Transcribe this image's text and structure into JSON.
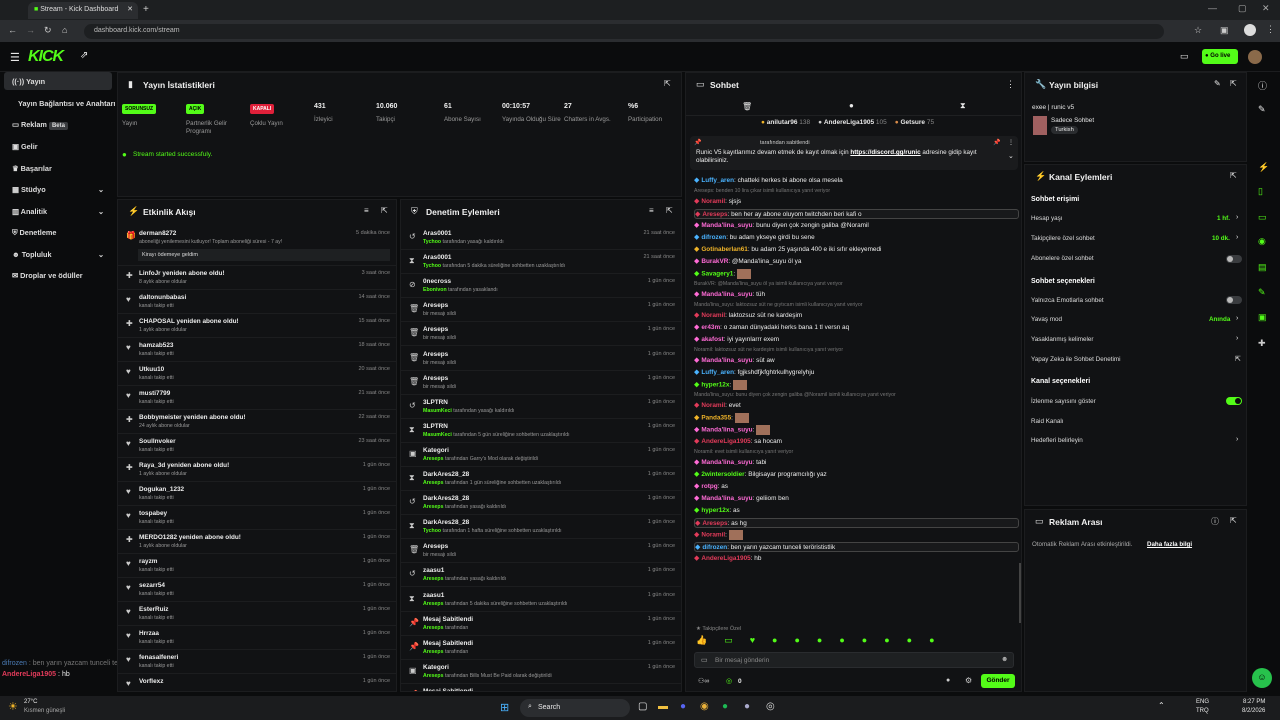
{
  "browser": {
    "tab_title": "Stream - Kick Dashboard",
    "url": "dashboard.kick.com/stream"
  },
  "topnav": {
    "logo": "KICK",
    "live_button": "Go live"
  },
  "sidebar": {
    "items": [
      {
        "label": "Yayın",
        "icon": "broadcast-icon"
      },
      {
        "label": "Yayın Bağlantısı ve Anahtarı",
        "icon": ""
      },
      {
        "label": "Reklam",
        "badge": "Beta",
        "icon": "megaphone-icon"
      },
      {
        "label": "Gelir",
        "icon": "money-icon"
      },
      {
        "label": "Başarılar",
        "icon": "trophy-icon"
      },
      {
        "label": "Stüdyo",
        "icon": "studio-icon"
      },
      {
        "label": "Analitik",
        "icon": "chart-icon"
      },
      {
        "label": "Denetleme",
        "icon": "shield-icon"
      },
      {
        "label": "Topluluk",
        "icon": "community-icon"
      },
      {
        "label": "Droplar ve ödüller",
        "icon": "gift-icon"
      }
    ]
  },
  "stats": {
    "title": "Yayın İstatistikleri",
    "notice": "Stream started successfuly.",
    "items": [
      {
        "badge": "SORUNSUZ",
        "label": "Yayın",
        "color": "#53fc18"
      },
      {
        "badge": "AÇIK",
        "label": "Partnerlik Gelir Programı",
        "color": "#53fc18"
      },
      {
        "badge": "KAPALI",
        "label": "Çoklu Yayın",
        "color": "#e0203a"
      },
      {
        "value": "431",
        "label": "İzleyici"
      },
      {
        "value": "10.060",
        "label": "Takipçi"
      },
      {
        "value": "61",
        "label": "Abone Sayısı"
      },
      {
        "value": "00:10:57",
        "label": "Yayında Olduğu Süre"
      },
      {
        "value": "27",
        "label": "Chatters in Avgs."
      },
      {
        "value": "%6",
        "label": "Participation"
      }
    ]
  },
  "activity": {
    "title": "Etkinlik Akışı",
    "items": [
      {
        "name": "derman8272",
        "sub": "aboneliği yenilemesini kutluyor! Toplam aboneliği süresi - 7 ay!",
        "time": "5 dakika önce",
        "extra": "Kirayı ödemeye geldim",
        "icon": "gift-icon"
      },
      {
        "name": "LinfoJr yeniden abone oldu!",
        "sub": "8 aylık abone oldular",
        "time": "3 saat önce",
        "icon": "star-icon"
      },
      {
        "name": "daltonunbabasi",
        "sub": "kanalı takip etti",
        "time": "14 saat önce",
        "icon": "heart-icon"
      },
      {
        "name": "CHAPOSAL yeniden abone oldu!",
        "sub": "1 aylık abone oldular",
        "time": "15 saat önce",
        "icon": "star-icon"
      },
      {
        "name": "hamzab523",
        "sub": "kanalı takip etti",
        "time": "18 saat önce",
        "icon": "heart-icon"
      },
      {
        "name": "Utkuu10",
        "sub": "kanalı takip etti",
        "time": "20 saat önce",
        "icon": "heart-icon"
      },
      {
        "name": "musti7799",
        "sub": "kanalı takip etti",
        "time": "21 saat önce",
        "icon": "heart-icon"
      },
      {
        "name": "Bobbymeister yeniden abone oldu!",
        "sub": "24 aylık abone oldular",
        "time": "22 saat önce",
        "icon": "star-icon"
      },
      {
        "name": "Soullnvoker",
        "sub": "kanalı takip etti",
        "time": "23 saat önce",
        "icon": "heart-icon"
      },
      {
        "name": "Raya_3d yeniden abone oldu!",
        "sub": "1 aylık abone oldular",
        "time": "1 gün önce",
        "icon": "star-icon"
      },
      {
        "name": "Dogukan_1232",
        "sub": "kanalı takip etti",
        "time": "1 gün önce",
        "icon": "heart-icon"
      },
      {
        "name": "tospabey",
        "sub": "kanalı takip etti",
        "time": "1 gün önce",
        "icon": "heart-icon"
      },
      {
        "name": "MERDO1282 yeniden abone oldu!",
        "sub": "1 aylık abone oldular",
        "time": "1 gün önce",
        "icon": "star-icon"
      },
      {
        "name": "rayzm",
        "sub": "kanalı takip etti",
        "time": "1 gün önce",
        "icon": "heart-icon"
      },
      {
        "name": "sezarr54",
        "sub": "kanalı takip etti",
        "time": "1 gün önce",
        "icon": "heart-icon"
      },
      {
        "name": "EsterRuiz",
        "sub": "kanalı takip etti",
        "time": "1 gün önce",
        "icon": "heart-icon"
      },
      {
        "name": "Hrrzaa",
        "sub": "kanalı takip etti",
        "time": "1 gün önce",
        "icon": "heart-icon"
      },
      {
        "name": "fenasalfeneri",
        "sub": "kanalı takip etti",
        "time": "1 gün önce",
        "icon": "heart-icon"
      },
      {
        "name": "Vorflexz",
        "sub": "",
        "time": "1 gün önce",
        "icon": "heart-icon"
      }
    ]
  },
  "moderation": {
    "title": "Denetim Eylemleri",
    "items": [
      {
        "name": "Aras0001",
        "actor": "Tychoo",
        "sub": "tarafından yasağı kaldırıldı",
        "time": "21 saat önce",
        "icon": "undo-icon"
      },
      {
        "name": "Aras0001",
        "actor": "Tychoo",
        "sub": "tarafından 5 dakika süreliğine sohbetten uzaklaştırıldı",
        "time": "21 saat önce",
        "icon": "hourglass-icon"
      },
      {
        "name": "0necross",
        "actor": "Ebonivon",
        "sub": "tarafından yasaklandı",
        "time": "1 gün önce",
        "icon": "ban-icon"
      },
      {
        "name": "Areseps",
        "actor": "",
        "sub": "bir mesajı sildi",
        "time": "1 gün önce",
        "icon": "trash-icon"
      },
      {
        "name": "Areseps",
        "actor": "",
        "sub": "bir mesajı sildi",
        "time": "1 gün önce",
        "icon": "trash-icon"
      },
      {
        "name": "Areseps",
        "actor": "",
        "sub": "bir mesajı sildi",
        "time": "1 gün önce",
        "icon": "trash-icon"
      },
      {
        "name": "Areseps",
        "actor": "",
        "sub": "bir mesajı sildi",
        "time": "1 gün önce",
        "icon": "trash-icon"
      },
      {
        "name": "3LPTRN",
        "actor": "MasumKeci",
        "sub": "tarafından yasağı kaldırıldı",
        "time": "1 gün önce",
        "icon": "undo-icon"
      },
      {
        "name": "3LPTRN",
        "actor": "MasumKeci",
        "sub": "tarafından 5 gün süreliğine sohbetten uzaklaştırıldı",
        "time": "1 gün önce",
        "icon": "hourglass-icon"
      },
      {
        "name": "Kategori",
        "actor": "Areseps",
        "sub": "tarafından Garry's Mod olarak değiştirildi",
        "time": "1 gün önce",
        "icon": "category-icon"
      },
      {
        "name": "DarkAres28_28",
        "actor": "Areseps",
        "sub": "tarafından 1 gün süreliğine sohbetten uzaklaştırıldı",
        "time": "1 gün önce",
        "icon": "hourglass-icon"
      },
      {
        "name": "DarkAres28_28",
        "actor": "Areseps",
        "sub": "tarafından yasağı kaldırıldı",
        "time": "1 gün önce",
        "icon": "undo-icon"
      },
      {
        "name": "DarkAres28_28",
        "actor": "Tychoo",
        "sub": "tarafından 1 hafta süreliğine sohbetten uzaklaştırıldı",
        "time": "1 gün önce",
        "icon": "hourglass-icon"
      },
      {
        "name": "Areseps",
        "actor": "",
        "sub": "bir mesajı sildi",
        "time": "1 gün önce",
        "icon": "trash-icon"
      },
      {
        "name": "zaasu1",
        "actor": "Areseps",
        "sub": "tarafından yasağı kaldırıldı",
        "time": "1 gün önce",
        "icon": "undo-icon"
      },
      {
        "name": "zaasu1",
        "actor": "Areseps",
        "sub": "tarafından 5 dakika süreliğine sohbetten uzaklaştırıldı",
        "time": "1 gün önce",
        "icon": "hourglass-icon"
      },
      {
        "name": "Mesaj Sabitlendi",
        "actor": "Areseps",
        "sub": "tarafından",
        "time": "1 gün önce",
        "icon": "pin-icon"
      },
      {
        "name": "Mesaj Sabitlendi",
        "actor": "Areseps",
        "sub": "tarafından",
        "time": "1 gün önce",
        "icon": "pin-icon"
      },
      {
        "name": "Kategori",
        "actor": "Areseps",
        "sub": "tarafından Bills Must Be Paid olarak değiştirildi",
        "time": "1 gün önce",
        "icon": "category-icon"
      },
      {
        "name": "Mesaj Sabitlendi",
        "actor": "",
        "sub": "",
        "time": "",
        "icon": "pin-icon"
      }
    ]
  },
  "chat": {
    "title": "Sohbet",
    "top_gifters": [
      {
        "name": "anilutar96",
        "count": "138",
        "color": "#f0b429"
      },
      {
        "name": "AndereLiga1905",
        "count": "105",
        "color": "#cfcfcf"
      },
      {
        "name": "Getsure",
        "count": "75",
        "color": "#d98c4a"
      }
    ],
    "pinned": {
      "by": "tarafından sabitlendi",
      "text": "Runic V5 kayıtlarımız devam etmek de kayıt olmak için",
      "link": "https://discord.gg/runic",
      "tail": "adresine gidip kayıt olabilirsiniz."
    },
    "messages": [
      {
        "name": "Luffy_aren",
        "color": "#4ab3ff",
        "text": "chatteki herkes bi abone olsa mesela"
      },
      {
        "name": "",
        "color": "#888",
        "text": "Areseps: benden 10 lira çıkar isimli kullanıcıya yanıt veriyor",
        "reply": true
      },
      {
        "name": "Noramil",
        "color": "#e23b5a",
        "text": "sjsjs"
      },
      {
        "name": "Areseps",
        "color": "#e23b5a",
        "text": "ben her ay abone oluyom twitchden beri kafi o",
        "highlight": true
      },
      {
        "name": "Manda'lina_suyu",
        "color": "#ff6bd6",
        "text": "bunu diyen çok zengin galiba @Noramil"
      },
      {
        "name": "difrozen",
        "color": "#4ab3ff",
        "text": "bu adam ykseye girdi bu sene"
      },
      {
        "name": "Gotinaberlan61",
        "color": "#f0b429",
        "text": "bu adam 25 yaşında 400 e iki sıfır ekleyemedi"
      },
      {
        "name": "BurakVR",
        "color": "#ff6bd6",
        "text": "@Manda'lina_suyu öl ya"
      },
      {
        "name": "Savagery1",
        "color": "#53fc18",
        "text": ""
      },
      {
        "name": "",
        "color": "#888",
        "text": "BurakVR: @Manda'lina_suyu öl ya isimli kullanıcıya yanıt veriyor",
        "reply": true
      },
      {
        "name": "Manda'lina_suyu",
        "color": "#ff6bd6",
        "text": "tüh"
      },
      {
        "name": "",
        "color": "#888",
        "text": "Manda'lina_suyu: laktozsuz süt ne gıytıcam isimli kullanıcıya yanıt veriyor",
        "reply": true
      },
      {
        "name": "Noramil",
        "color": "#e23b5a",
        "text": "laktozsuz süt ne kardeşim"
      },
      {
        "name": "er43m",
        "color": "#ff6bd6",
        "text": "o zaman dünyadaki herks bana 1 tl versn aq"
      },
      {
        "name": "akafost",
        "color": "#ff6bd6",
        "text": "iyi yayınlarrr exem"
      },
      {
        "name": "",
        "color": "#888",
        "text": "Noramil: laktozsuz süt ne kardeşim isimli kullanıcıya yanıt veriyor",
        "reply": true
      },
      {
        "name": "Manda'lina_suyu",
        "color": "#ff6bd6",
        "text": "süt aw"
      },
      {
        "name": "Luffy_aren",
        "color": "#4ab3ff",
        "text": "fgjkshdfjkfghtrkulhygrelyhju"
      },
      {
        "name": "hyper12x",
        "color": "#53fc18",
        "text": ""
      },
      {
        "name": "",
        "color": "#888",
        "text": "Manda'lina_suyu: bunu diyen çok zengin galiba @Noramil isimli kullanıcıya yanıt veriyor",
        "reply": true
      },
      {
        "name": "Noramil",
        "color": "#e23b5a",
        "text": "evet"
      },
      {
        "name": "Panda355",
        "color": "#f0b429",
        "text": ""
      },
      {
        "name": "Manda'lina_suyu",
        "color": "#ff6bd6",
        "text": ""
      },
      {
        "name": "AndereLiga1905",
        "color": "#e23b5a",
        "text": "sa hocam"
      },
      {
        "name": "",
        "color": "#888",
        "text": "Noramil: evet isimli kullanıcıya yanıt veriyor",
        "reply": true
      },
      {
        "name": "Manda'lina_suyu",
        "color": "#ff6bd6",
        "text": "tabi"
      },
      {
        "name": "2wintersoldier",
        "color": "#53fc18",
        "text": "Bilgisayar programcılığı yaz"
      },
      {
        "name": "rotpg",
        "color": "#ff6bd6",
        "text": "as"
      },
      {
        "name": "Manda'lina_suyu",
        "color": "#ff6bd6",
        "text": "geliiom ben"
      },
      {
        "name": "hyper12x",
        "color": "#53fc18",
        "text": "as"
      },
      {
        "name": "Areseps",
        "color": "#e23b5a",
        "text": "as hg",
        "highlight": true
      },
      {
        "name": "Noramil",
        "color": "#e23b5a",
        "text": ""
      },
      {
        "name": "difrozen",
        "color": "#4ab3ff",
        "text": "ben yarın yazcam tunceli terörististlik",
        "highlight": true
      },
      {
        "name": "AndereLiga1905",
        "color": "#e23b5a",
        "text": "hb"
      }
    ],
    "followers_only": "Takipçilere Özel",
    "input_placeholder": "Bir mesaj gönderin",
    "send_button": "Gönder",
    "points": "0"
  },
  "stream_info": {
    "title": "Yayın bilgisi",
    "stream_title": "exee | runic v5",
    "chat_mode": "Sadece Sohbet",
    "language": "Turkish"
  },
  "channel_actions": {
    "title": "Kanal Eylemleri",
    "chat_access": "Sohbet erişimi",
    "account_age_label": "Hesap yaşı",
    "account_age_value": "1 hf.",
    "followers_only_label": "Takipçilere özel sohbet",
    "followers_only_value": "10 dk.",
    "subs_only_label": "Abonelere özel sohbet",
    "chat_options": "Sohbet seçenekleri",
    "emotes_only_label": "Yalnızca Emotlarla sohbet",
    "slow_mode_label": "Yavaş mod",
    "slow_mode_value": "Anında",
    "banned_words_label": "Yasaklanmış kelimeler",
    "ai_mod_label": "Yapay Zeka ile Sohbet Denetimi",
    "channel_options": "Kanal seçenekleri",
    "show_viewers_label": "İzlenme sayısını göster",
    "raid_label": "Raid Kanalı",
    "goals_label": "Hedefleri belirleyin"
  },
  "ads": {
    "title": "Reklam Arası",
    "text": "Otomatik Reklam Arası etkinleştirildi.",
    "link": "Daha fazla bilgi"
  },
  "overlay_chat": [
    {
      "name": "difrozen",
      "text": "ben yarın yazcam tunceli terörististlik"
    },
    {
      "name": "AndereLiga1905",
      "text": "hb"
    }
  ],
  "taskbar": {
    "weather_temp": "27°C",
    "weather_text": "Kısmen güneşli",
    "search": "Search",
    "lang": "ENG",
    "lang2": "TRQ",
    "time": "8:27 PM",
    "date": "8/2/2026"
  },
  "colors": {
    "accent": "#53fc18",
    "danger": "#e0203a"
  }
}
